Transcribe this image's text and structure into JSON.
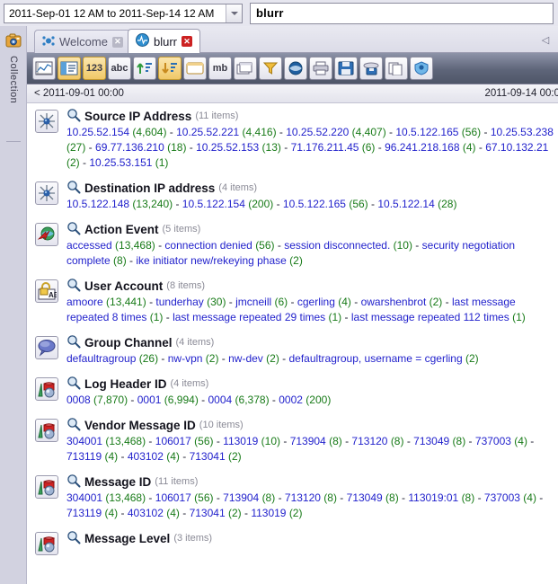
{
  "topbar": {
    "date_range": "2011-Sep-01 12 AM  to  2011-Sep-14 12 AM",
    "dropdown_icon": "chevron-down-icon",
    "search_value": "blurr",
    "search_placeholder": ""
  },
  "rail": {
    "icon": "collection-icon",
    "label": "Collection"
  },
  "tabs": [
    {
      "label": "Welcome",
      "icon": "welcome-icon",
      "close": "✕",
      "active": false
    },
    {
      "label": "blurr",
      "icon": "blurr-icon",
      "close": "✕",
      "active": true
    }
  ],
  "tab_scroll_icon": "chevron-left-icon",
  "toolbar": {
    "buttons": [
      {
        "name": "chart-icon",
        "glyph": "",
        "selected": false
      },
      {
        "name": "list-panel-icon",
        "glyph": "",
        "selected": true
      },
      {
        "name": "numeric-icon",
        "glyph": "123",
        "selected": true
      },
      {
        "name": "alpha-icon",
        "glyph": "abc",
        "selected": false
      },
      {
        "name": "sort-asc-icon",
        "glyph": "",
        "selected": false
      },
      {
        "name": "sort-desc-icon",
        "glyph": "",
        "selected": true
      },
      {
        "name": "window-icon",
        "glyph": "",
        "selected": false
      },
      {
        "name": "megabyte-icon",
        "glyph": "mb",
        "selected": false
      },
      {
        "name": "copy-windows-icon",
        "glyph": "",
        "selected": false
      },
      {
        "name": "filter-icon",
        "glyph": "",
        "selected": false
      },
      {
        "name": "globe-icon",
        "glyph": "",
        "selected": false
      },
      {
        "name": "print-icon",
        "glyph": "",
        "selected": false
      },
      {
        "name": "save-icon",
        "glyph": "",
        "selected": false
      },
      {
        "name": "save-all-icon",
        "glyph": "",
        "selected": false
      },
      {
        "name": "duplicate-icon",
        "glyph": "",
        "selected": false
      },
      {
        "name": "shield-icon",
        "glyph": "",
        "selected": false
      }
    ]
  },
  "timeline": {
    "left": "< 2011-09-01 00:00",
    "right": "2011-09-14 00:0"
  },
  "colors": {
    "value": "#2222cc",
    "count": "#177a17",
    "separator": "#222233",
    "title": "#12121c",
    "count_label": "#8a8a96",
    "toolbar_selected": "#f0c868"
  },
  "sections": [
    {
      "title": "Source IP Address",
      "count_label": "(11 items)",
      "icon": "network-hub-icon",
      "search_icon": "magnifier-icon",
      "items": [
        {
          "value": "10.25.52.154",
          "count": "(4,604)"
        },
        {
          "value": "10.25.52.221",
          "count": "(4,416)"
        },
        {
          "value": "10.25.52.220",
          "count": "(4,407)"
        },
        {
          "value": "10.5.122.165",
          "count": "(56)"
        },
        {
          "value": "10.25.53.238",
          "count": "(27)"
        },
        {
          "value": "69.77.136.210",
          "count": "(18)"
        },
        {
          "value": "10.25.52.153",
          "count": "(13)"
        },
        {
          "value": "71.176.211.45",
          "count": "(6)"
        },
        {
          "value": "96.241.218.168",
          "count": "(4)"
        },
        {
          "value": "67.10.132.21",
          "count": "(2)"
        },
        {
          "value": "10.25.53.151",
          "count": "(1)"
        }
      ]
    },
    {
      "title": "Destination IP address",
      "count_label": "(4 items)",
      "icon": "network-hub-icon",
      "search_icon": "magnifier-icon",
      "items": [
        {
          "value": "10.5.122.148",
          "count": "(13,240)"
        },
        {
          "value": "10.5.122.154",
          "count": "(200)"
        },
        {
          "value": "10.5.122.165",
          "count": "(56)"
        },
        {
          "value": "10.5.122.14",
          "count": "(28)"
        }
      ]
    },
    {
      "title": "Action Event",
      "count_label": "(5 items)",
      "icon": "action-globe-icon",
      "search_icon": "magnifier-icon",
      "items": [
        {
          "value": "accessed",
          "count": "(13,468)"
        },
        {
          "value": "connection denied",
          "count": "(56)"
        },
        {
          "value": "session disconnected.",
          "count": "(10)"
        },
        {
          "value": "security negotiation complete",
          "count": "(8)"
        },
        {
          "value": "ike initiator new/rekeying phase",
          "count": "(2)"
        }
      ]
    },
    {
      "title": "User Account",
      "count_label": "(8 items)",
      "icon": "lock-account-icon",
      "search_icon": "magnifier-icon",
      "items": [
        {
          "value": "amoore",
          "count": "(13,441)"
        },
        {
          "value": "tunderhay",
          "count": "(30)"
        },
        {
          "value": "jmcneill",
          "count": "(6)"
        },
        {
          "value": "cgerling",
          "count": "(4)"
        },
        {
          "value": "owarshenbrot",
          "count": "(2)"
        },
        {
          "value": "last message repeated 8 times",
          "count": "(1)"
        },
        {
          "value": "last message repeated 29 times",
          "count": "(1)"
        },
        {
          "value": "last message repeated 112 times",
          "count": "(1)"
        }
      ]
    },
    {
      "title": "Group Channel",
      "count_label": "(4 items)",
      "icon": "speech-bubble-icon",
      "search_icon": "magnifier-icon",
      "items": [
        {
          "value": "defaultragroup",
          "count": "(26)"
        },
        {
          "value": "nw-vpn",
          "count": "(2)"
        },
        {
          "value": "nw-dev",
          "count": "(2)"
        },
        {
          "value": "defaultragroup, username = cgerling",
          "count": "(2)"
        }
      ]
    },
    {
      "title": "Log Header ID",
      "count_label": "(4 items)",
      "icon": "shapes-icon",
      "search_icon": "magnifier-icon",
      "items": [
        {
          "value": "0008",
          "count": "(7,870)"
        },
        {
          "value": "0001",
          "count": "(6,994)"
        },
        {
          "value": "0004",
          "count": "(6,378)"
        },
        {
          "value": "0002",
          "count": "(200)"
        }
      ]
    },
    {
      "title": "Vendor Message ID",
      "count_label": "(10 items)",
      "icon": "shapes-icon",
      "search_icon": "magnifier-icon",
      "items": [
        {
          "value": "304001",
          "count": "(13,468)"
        },
        {
          "value": "106017",
          "count": "(56)"
        },
        {
          "value": "113019",
          "count": "(10)"
        },
        {
          "value": "713904",
          "count": "(8)"
        },
        {
          "value": "713120",
          "count": "(8)"
        },
        {
          "value": "713049",
          "count": "(8)"
        },
        {
          "value": "737003",
          "count": "(4)"
        },
        {
          "value": "713119",
          "count": "(4)"
        },
        {
          "value": "403102",
          "count": "(4)"
        },
        {
          "value": "713041",
          "count": "(2)"
        }
      ]
    },
    {
      "title": "Message ID",
      "count_label": "(11 items)",
      "icon": "shapes-icon",
      "search_icon": "magnifier-icon",
      "items": [
        {
          "value": "304001",
          "count": "(13,468)"
        },
        {
          "value": "106017",
          "count": "(56)"
        },
        {
          "value": "713904",
          "count": "(8)"
        },
        {
          "value": "713120",
          "count": "(8)"
        },
        {
          "value": "713049",
          "count": "(8)"
        },
        {
          "value": "113019:01",
          "count": "(8)"
        },
        {
          "value": "737003",
          "count": "(4)"
        },
        {
          "value": "713119",
          "count": "(4)"
        },
        {
          "value": "403102",
          "count": "(4)"
        },
        {
          "value": "713041",
          "count": "(2)"
        },
        {
          "value": "113019",
          "count": "(2)"
        }
      ]
    },
    {
      "title": "Message Level",
      "count_label": "(3 items)",
      "icon": "shapes-icon",
      "search_icon": "magnifier-icon",
      "items": []
    }
  ]
}
